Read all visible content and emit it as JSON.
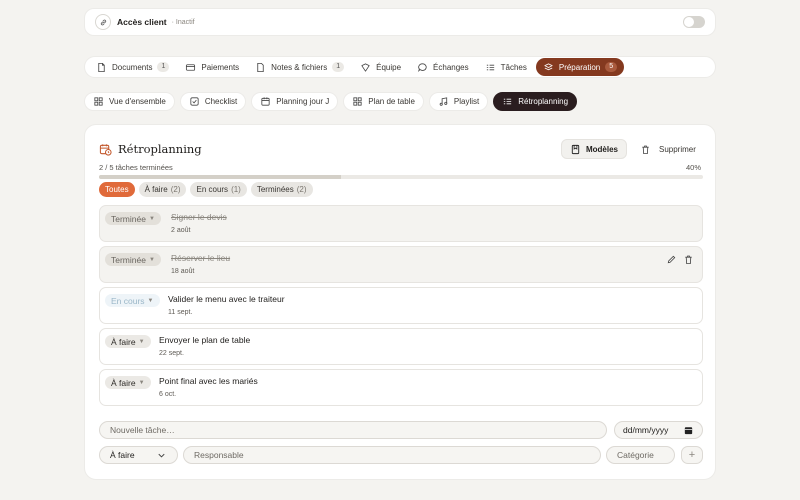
{
  "access": {
    "title": "Accès client",
    "status": "· Inactif"
  },
  "main_tabs": [
    {
      "label": "Documents",
      "count": "1",
      "icon": "file-icon"
    },
    {
      "label": "Paiements",
      "count": "",
      "icon": "credit-card-icon"
    },
    {
      "label": "Notes & fichiers",
      "count": "1",
      "icon": "note-icon"
    },
    {
      "label": "Équipe",
      "count": "",
      "icon": "team-icon"
    },
    {
      "label": "Échanges",
      "count": "",
      "icon": "chat-icon"
    },
    {
      "label": "Tâches",
      "count": "",
      "icon": "checklist-icon"
    },
    {
      "label": "Préparation",
      "count": "5",
      "icon": "layers-icon",
      "active": true
    }
  ],
  "sub_tabs": [
    {
      "label": "Vue d'ensemble",
      "icon": "grid-icon"
    },
    {
      "label": "Checklist",
      "icon": "checkbox-icon"
    },
    {
      "label": "Planning jour J",
      "icon": "calendar-icon"
    },
    {
      "label": "Plan de table",
      "icon": "grid-icon"
    },
    {
      "label": "Playlist",
      "icon": "music-icon"
    },
    {
      "label": "Rétroplanning",
      "icon": "list-icon",
      "active": true
    }
  ],
  "panel": {
    "title": "Rétroplanning",
    "models_label": "Modèles",
    "delete_label": "Supprimer",
    "progress_text": "2 / 5 tâches terminées",
    "progress_pct_label": "40%",
    "progress_fraction": 0.4,
    "filters": [
      {
        "label": "Toutes",
        "count": "",
        "active": true
      },
      {
        "label": "À faire",
        "count": "(2)"
      },
      {
        "label": "En cours",
        "count": "(1)"
      },
      {
        "label": "Terminées",
        "count": "(2)"
      }
    ]
  },
  "tasks": [
    {
      "status": "Terminée",
      "kind": "done",
      "title": "Signer le devis",
      "date": "2 août"
    },
    {
      "status": "Terminée",
      "kind": "done",
      "title": "Réserver le lieu",
      "date": "18 août",
      "hover": true
    },
    {
      "status": "En cours",
      "kind": "progress",
      "title": "Valider le menu avec le traiteur",
      "date": "11 sept."
    },
    {
      "status": "À faire",
      "kind": "todo",
      "title": "Envoyer le plan de table",
      "date": "22 sept."
    },
    {
      "status": "À faire",
      "kind": "todo",
      "title": "Point final avec les mariés",
      "date": "6 oct."
    }
  ],
  "form": {
    "new_task_placeholder": "Nouvelle tâche…",
    "date_placeholder": "dd/mm/yyyy",
    "status_value": "À faire",
    "owner_placeholder": "Responsable",
    "category_placeholder": "Catégorie",
    "add_label": "+"
  },
  "colors": {
    "accent": "#84391f",
    "filter_active": "#e06a3a",
    "dark_tab": "#2a1d1f"
  }
}
